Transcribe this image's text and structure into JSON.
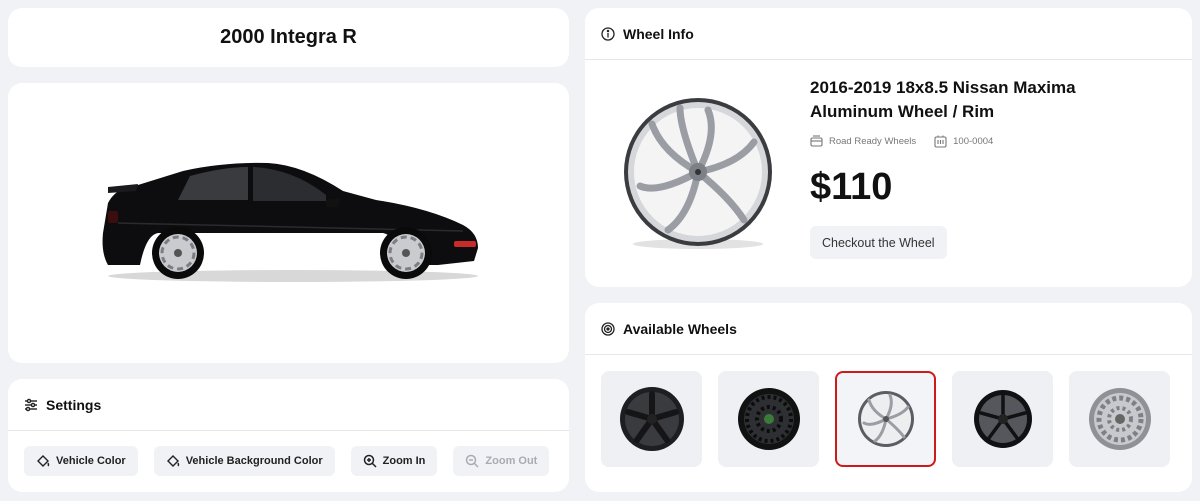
{
  "car": {
    "title": "2000 Integra R"
  },
  "settings": {
    "heading": "Settings",
    "buttons": {
      "vehicle_color": "Vehicle Color",
      "background_color": "Vehicle Background Color",
      "zoom_in": "Zoom In",
      "zoom_out": "Zoom Out"
    }
  },
  "wheel_info": {
    "heading": "Wheel Info",
    "name": "2016-2019 18x8.5 Nissan Maxima Aluminum Wheel / Rim",
    "vendor": "Road Ready Wheels",
    "sku": "100-0004",
    "price": "$110",
    "checkout_label": "Checkout the Wheel"
  },
  "available_wheels": {
    "heading": "Available Wheels",
    "items": [
      {
        "style": "black-5-spoke",
        "selected": false
      },
      {
        "style": "black-mesh",
        "selected": false
      },
      {
        "style": "chrome-swirl",
        "selected": true
      },
      {
        "style": "black-split-spoke",
        "selected": false
      },
      {
        "style": "silver-multi-spoke",
        "selected": false
      }
    ]
  },
  "colors": {
    "accent_selected": "#cc1b1b",
    "card_bg": "#ffffff",
    "page_bg": "#f1f2f6"
  }
}
